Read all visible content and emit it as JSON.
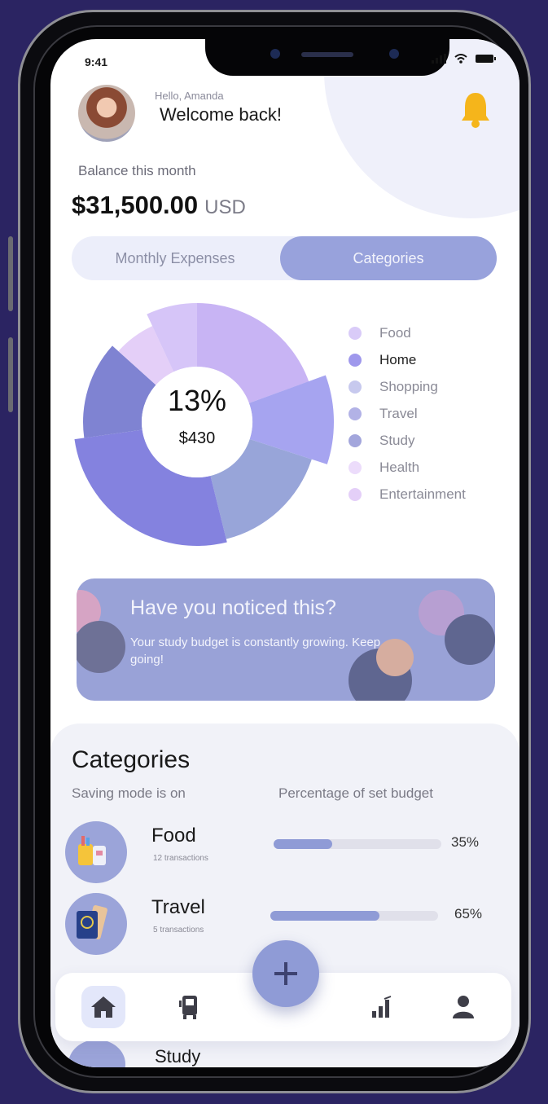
{
  "status_bar": {
    "time": "9:41"
  },
  "header": {
    "greeting": "Hello, Amanda",
    "welcome": "Welcome back!"
  },
  "balance": {
    "label": "Balance this month",
    "amount": "$31,500.00",
    "currency": "USD"
  },
  "tabs": [
    {
      "label": "Monthly Expenses",
      "active": false
    },
    {
      "label": "Categories",
      "active": true
    }
  ],
  "chart_data": {
    "type": "pie",
    "center_percent": "13%",
    "center_amount": "$430",
    "categories": [
      "Food",
      "Home",
      "Shopping",
      "Travel",
      "Study",
      "Health",
      "Entertainment"
    ],
    "legend_colors": [
      "#d9cbf8",
      "#9f98ec",
      "#c7c9ee",
      "#b2b2e6",
      "#a3a6dc",
      "#ecdcfb",
      "#e4cff8"
    ],
    "selected": "Home"
  },
  "insight": {
    "title": "Have you noticed this?",
    "text": "Your study budget is constantly growing. Keep going!"
  },
  "categories_section": {
    "title": "Categories",
    "subtitle": "Saving mode is on",
    "column_header": "Percentage of set budget",
    "items": [
      {
        "name": "Food",
        "transactions": "12 transactions",
        "percent_label": "35%",
        "percent": 0.35
      },
      {
        "name": "Travel",
        "transactions": "5 transactions",
        "percent_label": "65%",
        "percent": 0.65
      },
      {
        "name": "Study"
      }
    ]
  },
  "nav": {
    "items": [
      {
        "icon": "home-icon",
        "active": true
      },
      {
        "icon": "transport-icon",
        "active": false
      },
      {
        "icon": "stats-icon",
        "active": false
      },
      {
        "icon": "profile-icon",
        "active": false
      }
    ],
    "fab_icon": "plus-icon"
  },
  "colors": {
    "accent": "#98a2dc",
    "background": "#2b2462"
  }
}
